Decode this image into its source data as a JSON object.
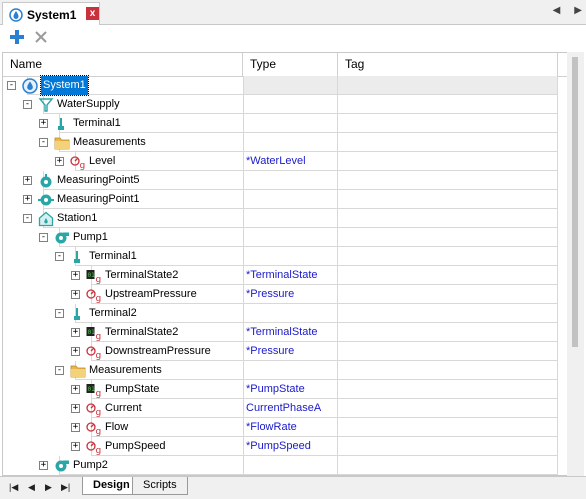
{
  "window": {
    "tab_title": "System1",
    "close_glyph": "x"
  },
  "toolbar": {
    "add_icon": "plus-icon",
    "delete_icon": "x-icon"
  },
  "columns": {
    "name": "Name",
    "type": "Type",
    "tag": "Tag"
  },
  "rows": [
    {
      "label": "System1",
      "type": "",
      "depth": 0,
      "expander": "-",
      "icon": "system-icon",
      "selected": true
    },
    {
      "label": "WaterSupply",
      "type": "",
      "depth": 1,
      "expander": "-",
      "icon": "water-supply-icon"
    },
    {
      "label": "Terminal1",
      "type": "",
      "depth": 2,
      "expander": "+",
      "icon": "terminal-icon"
    },
    {
      "label": "Measurements",
      "type": "",
      "depth": 2,
      "expander": "-",
      "icon": "folder-icon"
    },
    {
      "label": "Level",
      "type": "*WaterLevel",
      "depth": 3,
      "expander": "+",
      "icon": "measurement-icon"
    },
    {
      "label": "MeasuringPoint5",
      "type": "",
      "depth": 1,
      "expander": "+",
      "icon": "measuring-point-icon"
    },
    {
      "label": "MeasuringPoint1",
      "type": "",
      "depth": 1,
      "expander": "+",
      "icon": "measuring-point-alt-icon"
    },
    {
      "label": "Station1",
      "type": "",
      "depth": 1,
      "expander": "-",
      "icon": "station-icon"
    },
    {
      "label": "Pump1",
      "type": "",
      "depth": 2,
      "expander": "-",
      "icon": "pump-icon"
    },
    {
      "label": "Terminal1",
      "type": "",
      "depth": 3,
      "expander": "-",
      "icon": "terminal-icon"
    },
    {
      "label": "TerminalState2",
      "type": "*TerminalState",
      "depth": 4,
      "expander": "+",
      "icon": "state-icon"
    },
    {
      "label": "UpstreamPressure",
      "type": "*Pressure",
      "depth": 4,
      "expander": "+",
      "icon": "measurement-icon"
    },
    {
      "label": "Terminal2",
      "type": "",
      "depth": 3,
      "expander": "-",
      "icon": "terminal-icon"
    },
    {
      "label": "TerminalState2",
      "type": "*TerminalState",
      "depth": 4,
      "expander": "+",
      "icon": "state-icon"
    },
    {
      "label": "DownstreamPressure",
      "type": "*Pressure",
      "depth": 4,
      "expander": "+",
      "icon": "measurement-icon"
    },
    {
      "label": "Measurements",
      "type": "",
      "depth": 3,
      "expander": "-",
      "icon": "folder-icon"
    },
    {
      "label": "PumpState",
      "type": "*PumpState",
      "depth": 4,
      "expander": "+",
      "icon": "state-icon"
    },
    {
      "label": "Current",
      "type": "CurrentPhaseA",
      "depth": 4,
      "expander": "+",
      "icon": "measurement-icon"
    },
    {
      "label": "Flow",
      "type": "*FlowRate",
      "depth": 4,
      "expander": "+",
      "icon": "measurement-icon"
    },
    {
      "label": "PumpSpeed",
      "type": "*PumpSpeed",
      "depth": 4,
      "expander": "+",
      "icon": "measurement-icon"
    },
    {
      "label": "Pump2",
      "type": "",
      "depth": 2,
      "expander": "+",
      "icon": "pump-icon"
    }
  ],
  "sheet_tabs": [
    {
      "label": "Design",
      "active": true
    },
    {
      "label": "Scripts",
      "active": false
    }
  ],
  "colors": {
    "selection": "#0078d7",
    "type_text": "#1a1ac8",
    "accent_blue": "#2a7fd0",
    "close_red": "#c8323c"
  }
}
